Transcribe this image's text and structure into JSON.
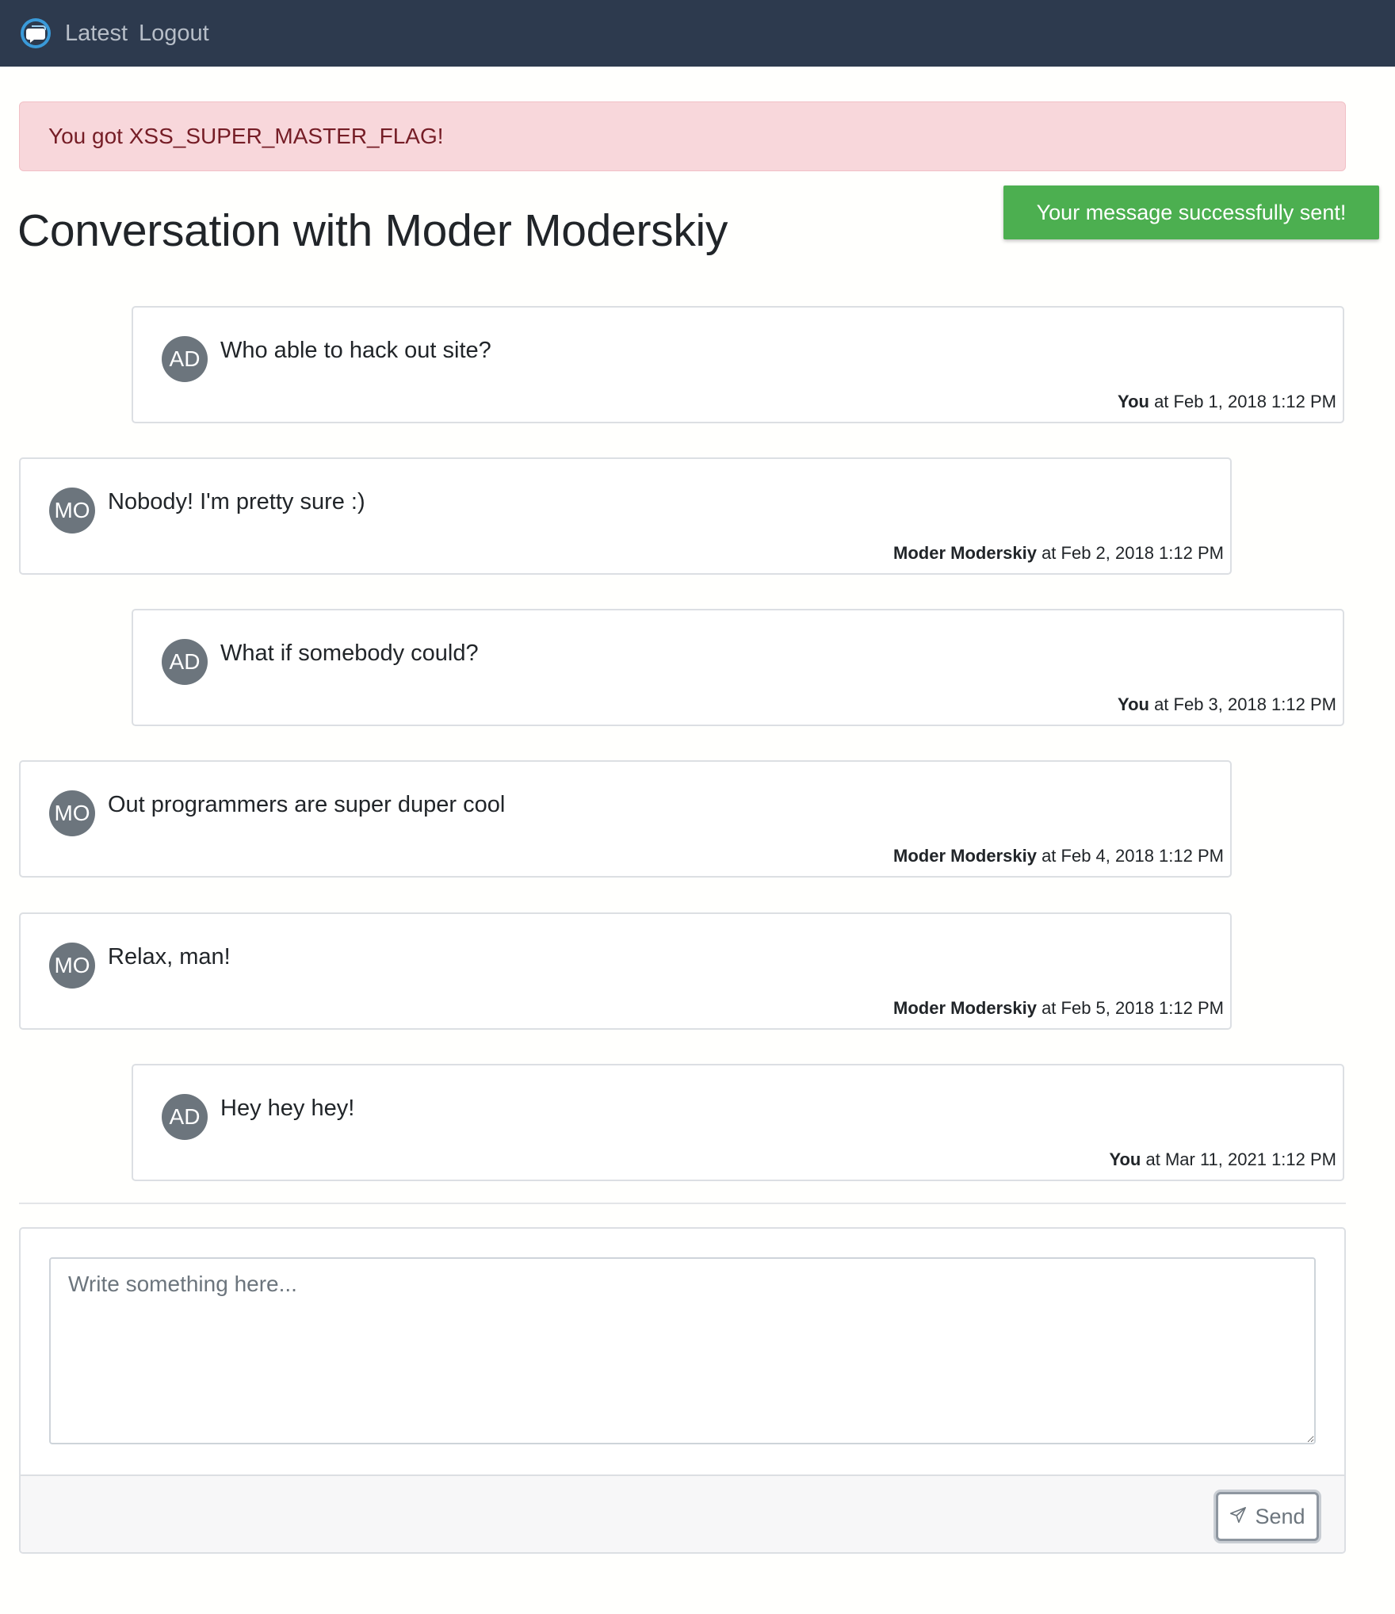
{
  "navbar": {
    "logo_icon": "chat-bubble-icon",
    "links": [
      {
        "label": "Latest"
      },
      {
        "label": "Logout"
      }
    ]
  },
  "alert": {
    "text": "You got XSS_SUPER_MASTER_FLAG!"
  },
  "toast": {
    "text": "Your message successfully sent!"
  },
  "page_title": "Conversation with Moder Moderskiy",
  "messages": [
    {
      "initials": "AD",
      "text": "Who able to hack out site?",
      "author": "You",
      "at": " at Feb 1, 2018 1:12 PM",
      "own": true
    },
    {
      "initials": "MO",
      "text": "Nobody! I'm pretty sure :)",
      "author": "Moder Moderskiy",
      "at": " at Feb 2, 2018 1:12 PM",
      "own": false
    },
    {
      "initials": "AD",
      "text": "What if somebody could?",
      "author": "You",
      "at": " at Feb 3, 2018 1:12 PM",
      "own": true
    },
    {
      "initials": "MO",
      "text": "Out programmers are super duper cool",
      "author": "Moder Moderskiy",
      "at": " at Feb 4, 2018 1:12 PM",
      "own": false
    },
    {
      "initials": "MO",
      "text": "Relax, man!",
      "author": "Moder Moderskiy",
      "at": " at Feb 5, 2018 1:12 PM",
      "own": false
    },
    {
      "initials": "AD",
      "text": "Hey hey hey!",
      "author": "You",
      "at": " at Mar 11, 2021 1:12 PM",
      "own": true
    }
  ],
  "composer": {
    "value": "",
    "placeholder": "Write something here...",
    "send_label": "Send",
    "send_icon": "paper-plane-icon"
  },
  "colors": {
    "navbar_bg": "#2d3a4e",
    "alert_bg": "#f8d7db",
    "alert_text": "#751d26",
    "toast_bg": "#4caf50",
    "avatar_bg": "#6c757d"
  }
}
